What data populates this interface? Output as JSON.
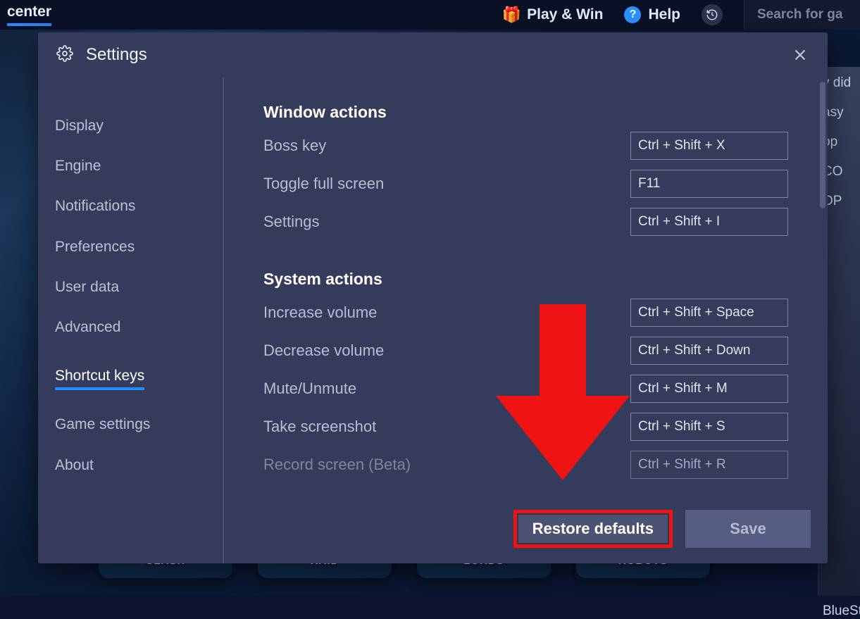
{
  "topbar": {
    "brand": "center",
    "play_win": "Play & Win",
    "help": "Help",
    "search_placeholder": "Search for ga"
  },
  "modal": {
    "title": "Settings"
  },
  "sidebar": {
    "items": [
      {
        "label": "Display"
      },
      {
        "label": "Engine"
      },
      {
        "label": "Notifications"
      },
      {
        "label": "Preferences"
      },
      {
        "label": "User data"
      },
      {
        "label": "Advanced"
      },
      {
        "label": "Shortcut keys"
      },
      {
        "label": "Game settings"
      },
      {
        "label": "About"
      }
    ]
  },
  "content": {
    "section1": {
      "title": "Window actions",
      "rows": [
        {
          "label": "Boss key",
          "key": "Ctrl + Shift + X"
        },
        {
          "label": "Toggle full screen",
          "key": "F11"
        },
        {
          "label": "Settings",
          "key": "Ctrl + Shift + I"
        }
      ]
    },
    "section2": {
      "title": "System actions",
      "rows": [
        {
          "label": "Increase volume",
          "key": "Ctrl + Shift + Space"
        },
        {
          "label": "Decrease volume",
          "key": "Ctrl + Shift + Down"
        },
        {
          "label": "Mute/Unmute",
          "key": "Ctrl + Shift + M"
        },
        {
          "label": "Take screenshot",
          "key": "Ctrl + Shift + S"
        },
        {
          "label": "Record screen (Beta)",
          "key": "Ctrl + Shift + R"
        }
      ]
    }
  },
  "footer": {
    "restore": "Restore defaults",
    "save": "Save"
  },
  "bg": {
    "tiles": [
      "CLASH",
      "RAID",
      "LORDS",
      "ROBOTS"
    ],
    "side": [
      "y did",
      "asy",
      "op",
      "CO",
      "OP",
      "BlueStacks on"
    ]
  }
}
